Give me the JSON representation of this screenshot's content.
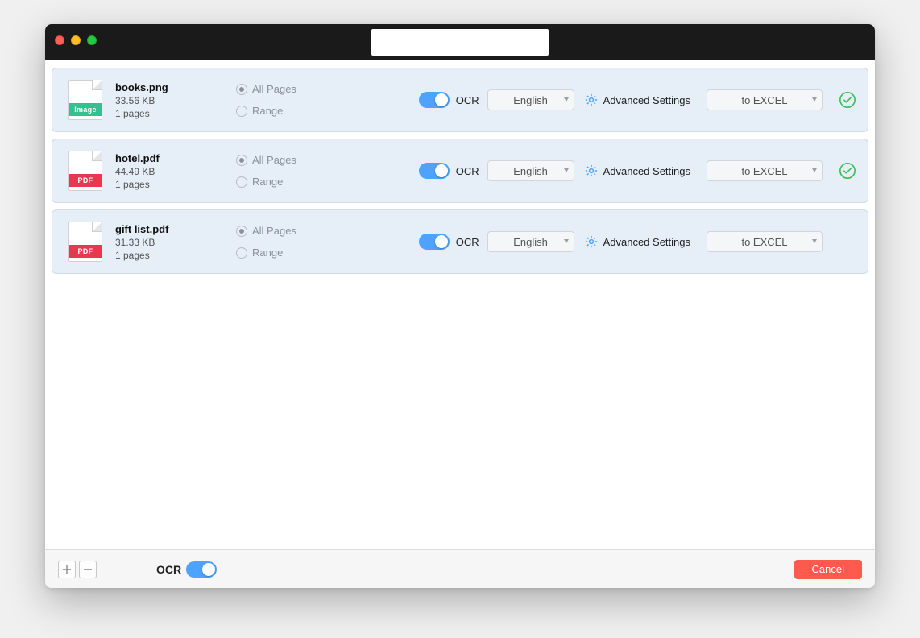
{
  "title": "",
  "rows": [
    {
      "icon_type": "image",
      "icon_tag_text": "Image",
      "name": "books.png",
      "size": "33.56 KB",
      "pages": "1 pages",
      "allpages_label": "All Pages",
      "range_label": "Range",
      "ocr_label": "OCR",
      "lang": "English",
      "adv_label": "Advanced Settings",
      "format": "to EXCEL",
      "done": true
    },
    {
      "icon_type": "pdf",
      "icon_tag_text": "PDF",
      "name": "hotel.pdf",
      "size": "44.49 KB",
      "pages": "1 pages",
      "allpages_label": "All Pages",
      "range_label": "Range",
      "ocr_label": "OCR",
      "lang": "English",
      "adv_label": "Advanced Settings",
      "format": "to EXCEL",
      "done": true
    },
    {
      "icon_type": "pdf",
      "icon_tag_text": "PDF",
      "name": "gift list.pdf",
      "size": "31.33 KB",
      "pages": "1 pages",
      "allpages_label": "All Pages",
      "range_label": "Range",
      "ocr_label": "OCR",
      "lang": "English",
      "adv_label": "Advanced Settings",
      "format": "to EXCEL",
      "done": false
    }
  ],
  "footer": {
    "ocr_label": "OCR",
    "cancel_label": "Cancel"
  }
}
